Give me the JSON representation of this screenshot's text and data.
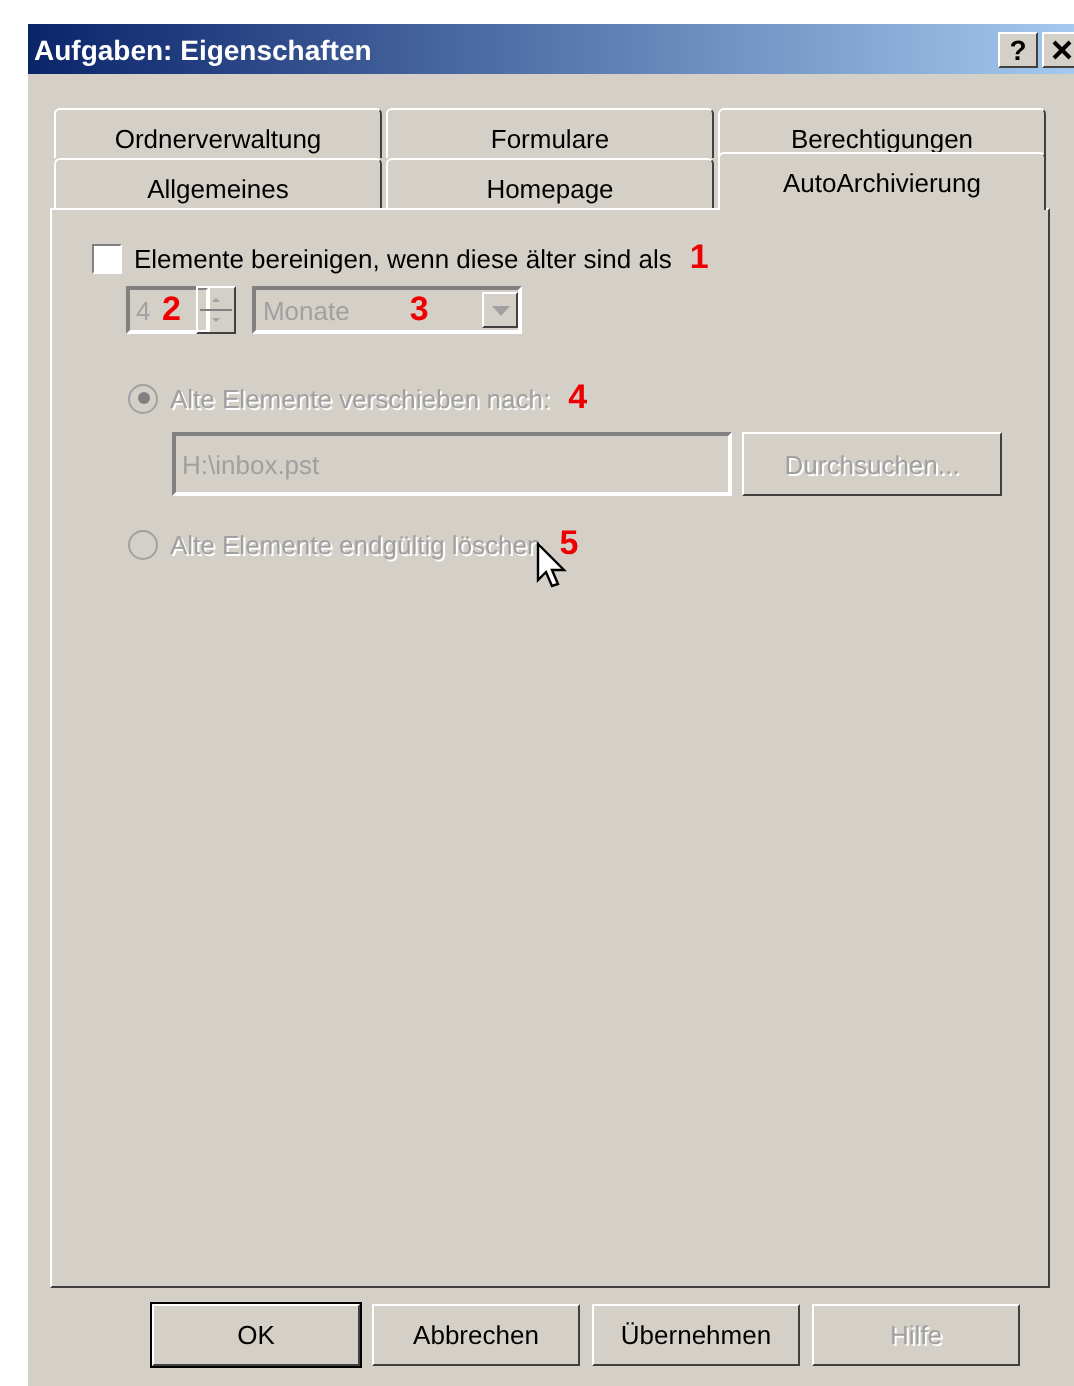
{
  "window": {
    "title": "Aufgaben: Eigenschaften",
    "help_button": "?"
  },
  "tab_rows": [
    [
      {
        "label": "Ordnerverwaltung",
        "selected": false
      },
      {
        "label": "Formulare",
        "selected": false
      },
      {
        "label": "Berechtigungen",
        "selected": false
      }
    ],
    [
      {
        "label": "Allgemeines",
        "selected": false
      },
      {
        "label": "Homepage",
        "selected": false
      },
      {
        "label": "AutoArchivierung",
        "selected": true
      }
    ]
  ],
  "cleanup": {
    "label": "Elemente bereinigen, wenn diese älter sind als",
    "checked": false,
    "marker": "1"
  },
  "age": {
    "value": "4",
    "disabled": true,
    "marker": "2"
  },
  "unit": {
    "value": "Monate",
    "disabled": true,
    "marker": "3"
  },
  "options": [
    {
      "label": "Alte Elemente verschieben nach:",
      "selected": true,
      "disabled": true,
      "marker": "4"
    },
    {
      "label": "Alte Elemente endgültig löschen",
      "selected": false,
      "disabled": true,
      "marker": "5"
    }
  ],
  "path": {
    "value": "H:\\inbox.pst",
    "disabled": true
  },
  "browse_button": {
    "label": "Durchsuchen...",
    "disabled": true
  },
  "buttons": [
    {
      "label": "OK",
      "default": true,
      "disabled": false
    },
    {
      "label": "Abbrechen",
      "default": false,
      "disabled": false
    },
    {
      "label": "Übernehmen",
      "default": false,
      "disabled": false
    },
    {
      "label": "Hilfe",
      "default": false,
      "disabled": true
    }
  ]
}
